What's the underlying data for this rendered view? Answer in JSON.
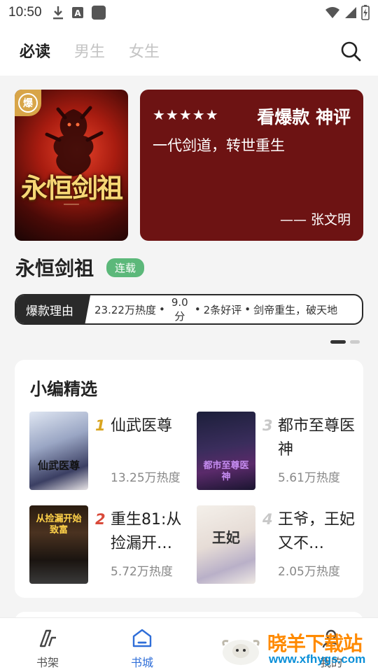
{
  "status_bar": {
    "time": "10:50"
  },
  "tabs": [
    {
      "label": "必读",
      "active": true
    },
    {
      "label": "男生",
      "active": false
    },
    {
      "label": "女生",
      "active": false
    }
  ],
  "banner": {
    "cover_title": "永恒剑祖",
    "cover_badge": "爆",
    "stars": "★★★★★",
    "review_tag": "看爆款 神评",
    "review_quote": "一代剑道，转世重生",
    "review_author": "—— 张文明"
  },
  "book": {
    "title": "永恒剑祖",
    "status": "连载"
  },
  "reason": {
    "label": "爆款理由",
    "heat": "23.22万热度",
    "score": "9.0分",
    "reviews": "2条好评",
    "tagline": "剑帝重生，破天地"
  },
  "picks": {
    "title": "小编精选",
    "items": [
      {
        "rank": "1",
        "name": "仙武医尊",
        "heat": "13.25万热度",
        "rank_color": "#d9a520",
        "cover_text": "仙武医尊"
      },
      {
        "rank": "3",
        "name": "都市至尊医神",
        "heat": "5.61万热度",
        "rank_color": "#c8c8c8",
        "cover_text": "都市至尊医神"
      },
      {
        "rank": "2",
        "name": "重生81:从捡漏开…",
        "heat": "5.72万热度",
        "rank_color": "#d94a3a",
        "cover_text": "从捡漏开始致富"
      },
      {
        "rank": "4",
        "name": "王爷，王妃又不…",
        "heat": "2.05万热度",
        "rank_color": "#c8c8c8",
        "cover_text": "王妃"
      }
    ]
  },
  "bottom_nav": [
    {
      "label": "书架",
      "icon": "bookshelf-icon",
      "active": false
    },
    {
      "label": "书城",
      "icon": "bookstore-icon",
      "active": true
    },
    {
      "label": "我的",
      "icon": "profile-icon",
      "active": false
    }
  ],
  "watermark": {
    "text": "晓羊下载站",
    "url": "www.xfhygs.com"
  },
  "colors": {
    "accent": "#2f6ed8",
    "review_bg": "#6d1313",
    "status_tag": "#5cb87a"
  }
}
